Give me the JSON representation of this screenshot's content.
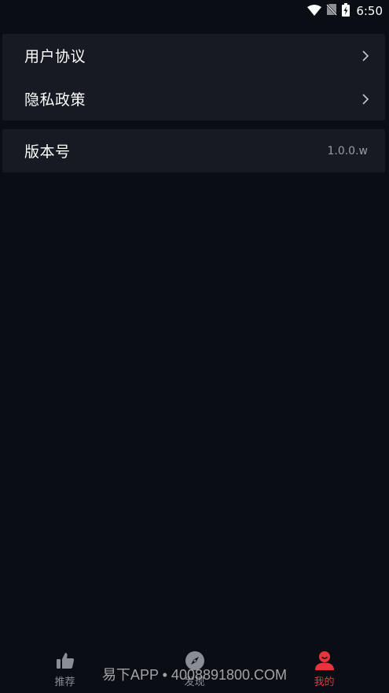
{
  "status_bar": {
    "time": "6:50",
    "icons": [
      "wifi-icon",
      "no-sim-icon",
      "battery-charging-icon"
    ]
  },
  "settings": {
    "groups": [
      {
        "items": [
          {
            "label": "用户协议",
            "icon": "chevron-right-icon"
          },
          {
            "label": "隐私政策",
            "icon": "chevron-right-icon"
          }
        ]
      },
      {
        "items": [
          {
            "label": "版本号",
            "value": "1.0.0.w"
          }
        ]
      }
    ]
  },
  "tabbar": {
    "tabs": [
      {
        "label": "推荐",
        "icon": "thumbs-up-icon",
        "active": false
      },
      {
        "label": "发现",
        "icon": "compass-icon",
        "active": false
      },
      {
        "label": "我的",
        "icon": "user-icon",
        "active": true
      }
    ],
    "active_color": "#e8353b",
    "inactive_color": "#8b8d96"
  },
  "watermark": "易下APP • 4008891800.COM",
  "colors": {
    "background": "#0b0d14",
    "card": "#171923"
  }
}
